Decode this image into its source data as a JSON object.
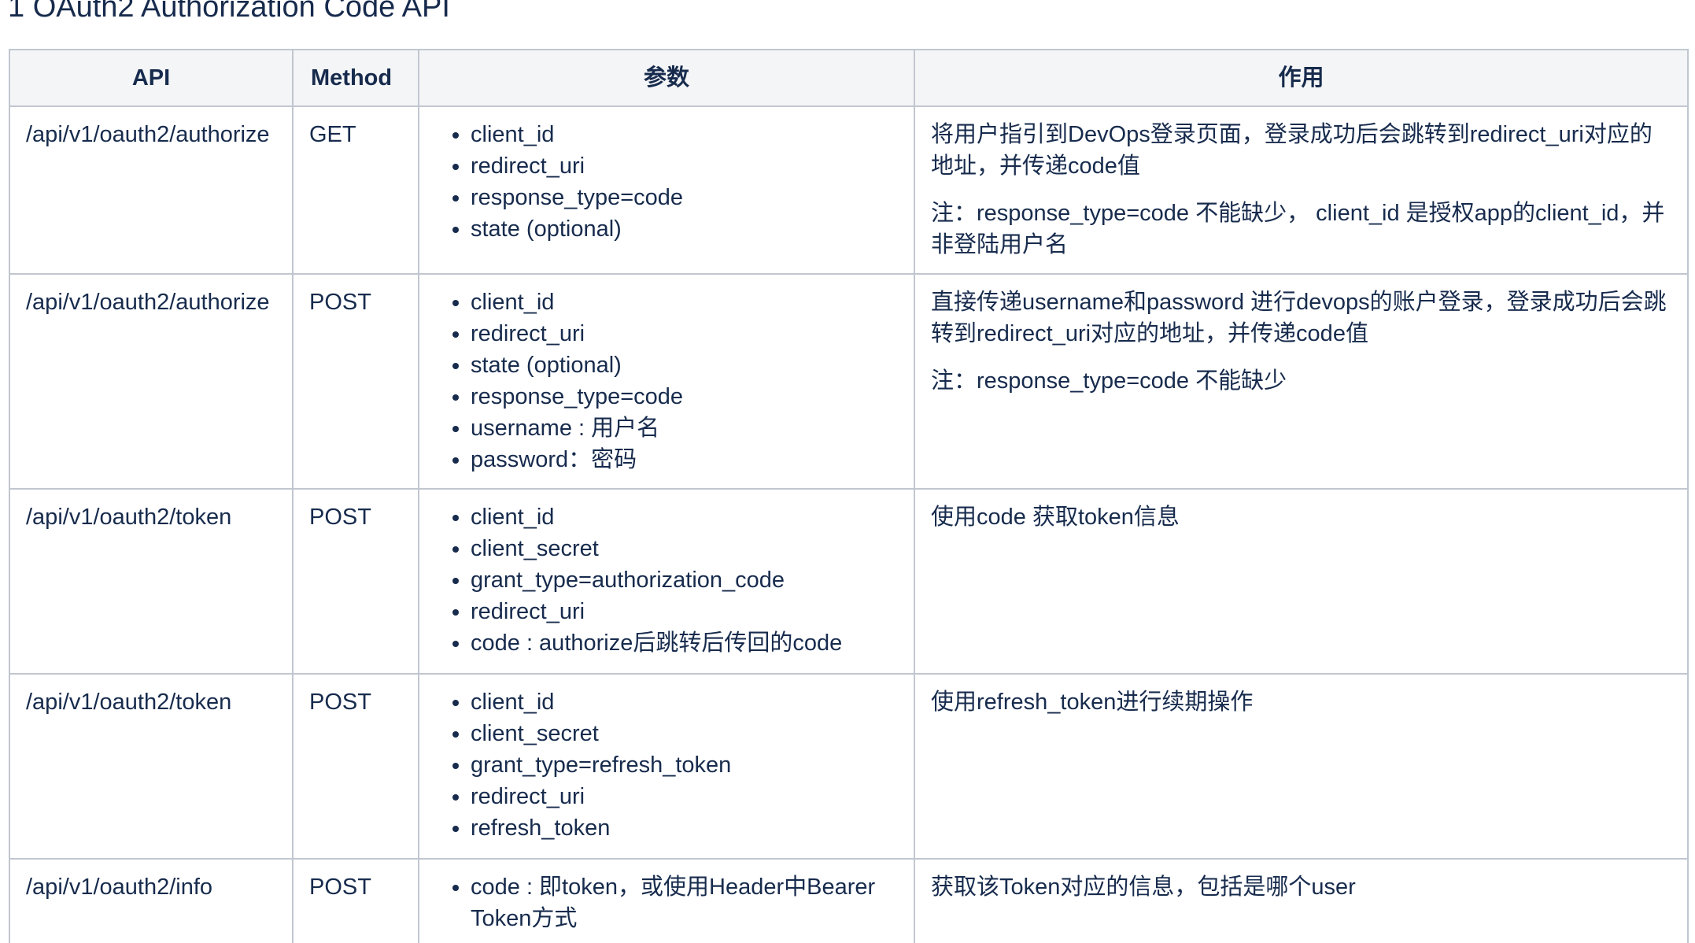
{
  "heading": "1 OAuth2 Authorization Code API",
  "table": {
    "headers": {
      "api": "API",
      "method": "Method",
      "params": "参数",
      "purpose": "作用"
    },
    "rows": [
      {
        "api": "/api/v1/oauth2/authorize",
        "method": "GET",
        "params": [
          "client_id",
          "redirect_uri",
          "response_type=code",
          "state (optional)"
        ],
        "description": [
          "将用户指引到DevOps登录页面，登录成功后会跳转到redirect_uri对应的地址，并传递code值",
          "注：response_type=code 不能缺少，  client_id 是授权app的client_id，并非登陆用户名"
        ]
      },
      {
        "api": "/api/v1/oauth2/authorize",
        "method": "POST",
        "params": [
          "client_id",
          "redirect_uri",
          "state (optional)",
          "response_type=code",
          "username : 用户名",
          "password：密码"
        ],
        "description": [
          "直接传递username和password 进行devops的账户登录，登录成功后会跳转到redirect_uri对应的地址，并传递code值",
          "注：response_type=code 不能缺少"
        ]
      },
      {
        "api": "/api/v1/oauth2/token",
        "method": "POST",
        "params": [
          "client_id",
          "client_secret",
          "grant_type=authorization_code",
          "redirect_uri",
          "code : authorize后跳转后传回的code"
        ],
        "description": [
          "使用code 获取token信息"
        ]
      },
      {
        "api": "/api/v1/oauth2/token",
        "method": "POST",
        "params": [
          "client_id",
          "client_secret",
          "grant_type=refresh_token",
          "redirect_uri",
          "refresh_token"
        ],
        "description": [
          "使用refresh_token进行续期操作"
        ]
      },
      {
        "api": "/api/v1/oauth2/info",
        "method": "POST",
        "params": [
          "code : 即token，或使用Header中Bearer Token方式"
        ],
        "description": [
          "获取该Token对应的信息，包括是哪个user"
        ]
      }
    ]
  }
}
